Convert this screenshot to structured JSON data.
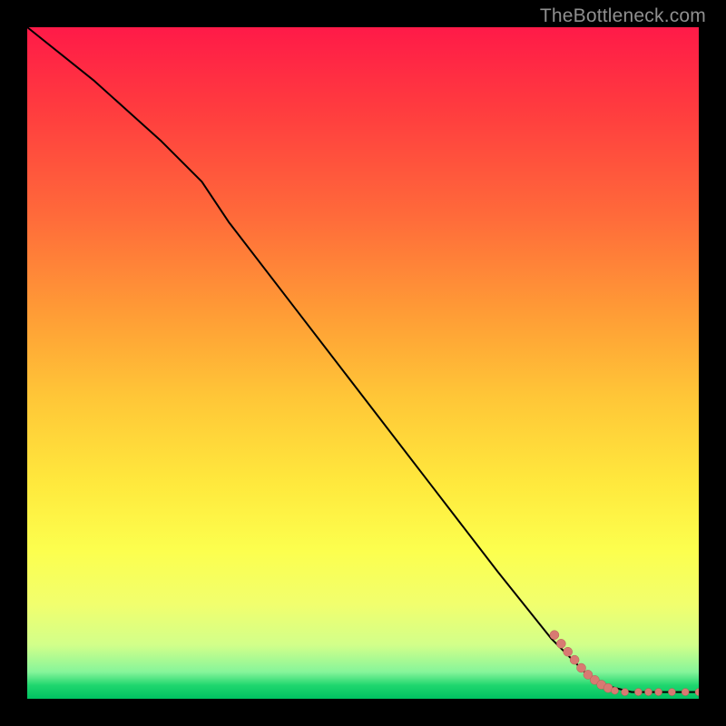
{
  "credit": "TheBottleneck.com",
  "chart_data": {
    "type": "line",
    "title": "",
    "xlabel": "",
    "ylabel": "",
    "xlim": [
      0,
      100
    ],
    "ylim": [
      0,
      100
    ],
    "grid": false,
    "legend": false,
    "series": [
      {
        "name": "curve",
        "x": [
          0,
          10,
          20,
          26,
          30,
          40,
          50,
          60,
          70,
          78,
          83,
          86,
          90,
          95,
          100
        ],
        "y": [
          100,
          92,
          83,
          77,
          71,
          58,
          45,
          32,
          19,
          9,
          4,
          2,
          1,
          1,
          1
        ]
      }
    ],
    "markers": [
      {
        "x": 78.5,
        "y": 9.5,
        "r": 5
      },
      {
        "x": 79.5,
        "y": 8.2,
        "r": 5
      },
      {
        "x": 80.5,
        "y": 7.0,
        "r": 5
      },
      {
        "x": 81.5,
        "y": 5.8,
        "r": 5
      },
      {
        "x": 82.5,
        "y": 4.6,
        "r": 5
      },
      {
        "x": 83.5,
        "y": 3.6,
        "r": 5
      },
      {
        "x": 84.5,
        "y": 2.8,
        "r": 5
      },
      {
        "x": 85.5,
        "y": 2.1,
        "r": 5
      },
      {
        "x": 86.5,
        "y": 1.6,
        "r": 5
      },
      {
        "x": 87.5,
        "y": 1.2,
        "r": 4
      },
      {
        "x": 89.0,
        "y": 1.0,
        "r": 4
      },
      {
        "x": 91.0,
        "y": 1.0,
        "r": 4
      },
      {
        "x": 92.5,
        "y": 1.0,
        "r": 4
      },
      {
        "x": 94.0,
        "y": 1.0,
        "r": 4
      },
      {
        "x": 96.0,
        "y": 1.0,
        "r": 4
      },
      {
        "x": 98.0,
        "y": 1.0,
        "r": 4
      },
      {
        "x": 100.0,
        "y": 1.0,
        "r": 4
      }
    ]
  }
}
